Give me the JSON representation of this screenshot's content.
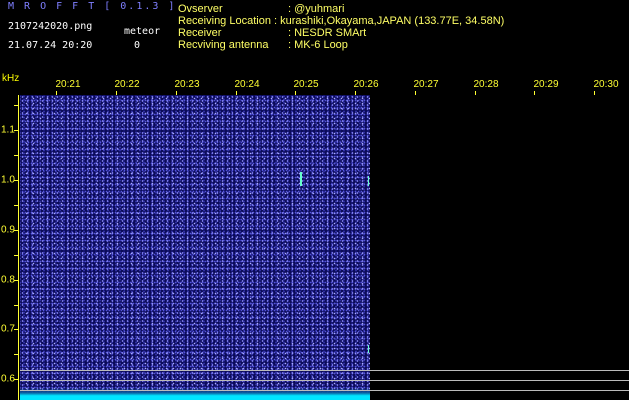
{
  "header": {
    "app_title": "M R O F F T [ 0.1.3 ]",
    "filename": "2107242020.png",
    "datetime": "21.07.24 20:20",
    "meteor_label": "meteor",
    "meteor_count": "0"
  },
  "info": {
    "observer_label": "Ovserver",
    "observer_value": ": @yuhmari",
    "location_label": "Receiving Location",
    "location_value": ": kurashiki,Okayama,JAPAN (133.77E, 34.58N)",
    "receiver_label": "Receiver",
    "receiver_value": ": NESDR SMArt",
    "antenna_label": "Recviving antenna",
    "antenna_value": ": MK-6 Loop"
  },
  "axis": {
    "freq_unit": "kHz",
    "time_ticks": [
      "20:21",
      "20:22",
      "20:23",
      "20:24",
      "20:25",
      "20:26",
      "20:27",
      "20:28",
      "20:29",
      "20:30"
    ],
    "freq_ticks": [
      "1.1",
      "1.0",
      "0.9",
      "0.8",
      "0.7",
      "0.6"
    ]
  },
  "colors": {
    "title": "#7f7fff",
    "info_text": "#ffff66",
    "axis": "#ffff33",
    "waterfall_bg": "#0b0b5a",
    "noise_floor": "#00e5ff"
  }
}
